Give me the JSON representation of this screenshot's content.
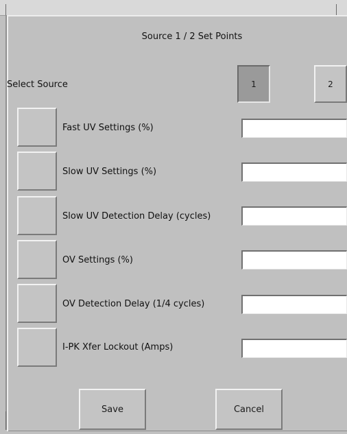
{
  "dialog": {
    "title": "Source 1 / 2 Set Points"
  },
  "source_select": {
    "label": "Select Source",
    "options": [
      "1",
      "2"
    ],
    "selected": "1"
  },
  "settings": [
    {
      "label": "Fast UV Settings (%)",
      "value": ""
    },
    {
      "label": "Slow UV Settings (%)",
      "value": ""
    },
    {
      "label": "Slow UV Detection Delay (cycles)",
      "value": ""
    },
    {
      "label": "OV Settings (%)",
      "value": ""
    },
    {
      "label": "OV Detection Delay (1/4 cycles)",
      "value": ""
    },
    {
      "label": "I-PK Xfer Lockout (Amps)",
      "value": ""
    }
  ],
  "actions": {
    "save_label": "Save",
    "cancel_label": "Cancel"
  }
}
